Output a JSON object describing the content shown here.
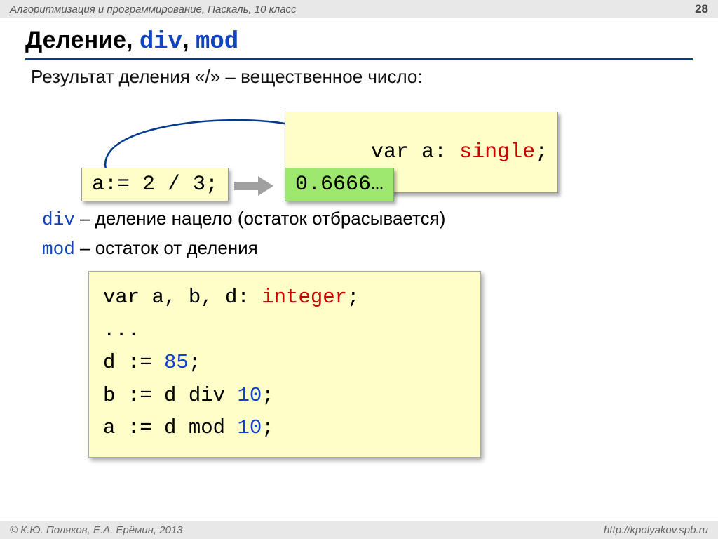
{
  "header": {
    "subject": "Алгоритмизация и программирование, Паскаль, 10 класс",
    "page": "28"
  },
  "title": {
    "t1": "Деление",
    "comma1": ", ",
    "div": "div",
    "comma2": ", ",
    "mod": "mod"
  },
  "desc": "Результат деления «/» – вещественное число:",
  "box_var": {
    "p1": "var a: ",
    "p2": "single",
    "p3": ";"
  },
  "box_assign": "a:= 2 / 3;",
  "box_result": "0.6666…",
  "expl1": {
    "kw": "div",
    "txt": " – деление нацело (остаток отбрасывается)"
  },
  "expl2": {
    "kw": "mod",
    "txt": " – остаток от деления"
  },
  "code": {
    "l1a": "var a, b, d: ",
    "l1b": "integer",
    "l1c": ";",
    "l2": "...",
    "l3a": "d := ",
    "l3b": "85",
    "l3c": ";",
    "l4a": "b := d div ",
    "l4b": "10",
    "l4c": ";",
    "l5a": "a := d mod ",
    "l5b": "10",
    "l5c": ";"
  },
  "footer": {
    "left": "© К.Ю. Поляков, Е.А. Ерёмин, 2013",
    "right": "http://kpolyakov.spb.ru"
  }
}
